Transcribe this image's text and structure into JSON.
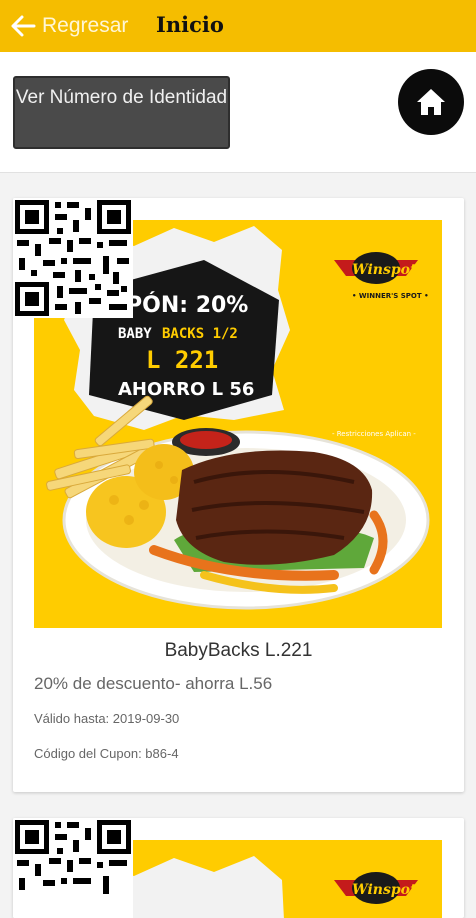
{
  "header": {
    "back_label": "Regresar",
    "title": "Inicio",
    "background": "#f5bd00"
  },
  "toolbar": {
    "id_button_label": "Ver Número de Identidad",
    "home_icon": "home-icon"
  },
  "coupons": [
    {
      "title": "BabyBacks L.221",
      "description": "20% de descuento- ahorra L.56",
      "valid_until": "Válido hasta: 2019-09-30",
      "code": "Código del Cupon: b86-4",
      "image": {
        "coupon_text": "PÓN: 20%",
        "item_line1": "BABY",
        "item_line2": "BACKS 1/2",
        "price": "L 221",
        "savings": "AHORRO L 56",
        "restrictions": "- Restricciones Aplican -",
        "brand": "Winspot",
        "brand_tagline": "• WINNER'S SPOT •"
      }
    },
    {
      "image": {
        "brand": "Winspot"
      }
    }
  ]
}
